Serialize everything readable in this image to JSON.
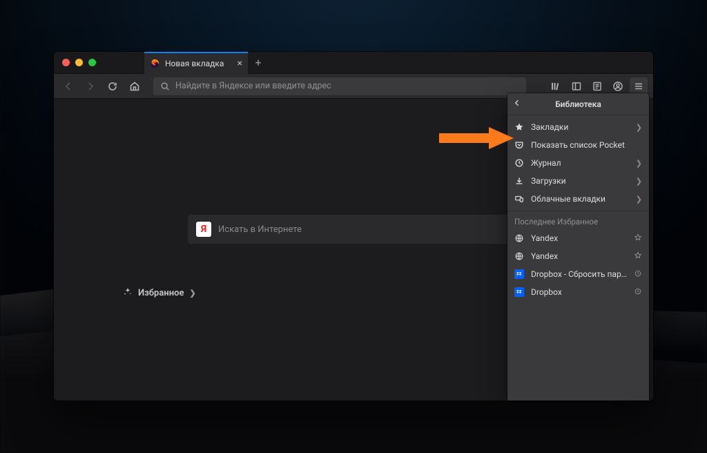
{
  "tab": {
    "title": "Новая вкладка",
    "close": "×"
  },
  "toolbar": {
    "url_placeholder": "Найдите в Яндексе или введите адрес"
  },
  "content": {
    "search_placeholder": "Искать в Интернете",
    "favorites_label": "Избранное"
  },
  "panel": {
    "title": "Библиотека",
    "items": [
      {
        "label": "Закладки",
        "icon": "star",
        "arrow": true
      },
      {
        "label": "Показать список Pocket",
        "icon": "pocket",
        "arrow": false
      },
      {
        "label": "Журнал",
        "icon": "history",
        "arrow": true
      },
      {
        "label": "Загрузки",
        "icon": "download",
        "arrow": true
      },
      {
        "label": "Облачные вкладки",
        "icon": "cloud-tabs",
        "arrow": true
      }
    ],
    "recent_label": "Последнее Избранное",
    "recent": [
      {
        "label": "Yandex",
        "icon": "globe",
        "trail": "star"
      },
      {
        "label": "Yandex",
        "icon": "globe",
        "trail": "star"
      },
      {
        "label": "Dropbox - Сбросить пароль",
        "icon": "dropbox",
        "trail": "clock"
      },
      {
        "label": "Dropbox",
        "icon": "dropbox",
        "trail": "clock"
      }
    ]
  }
}
